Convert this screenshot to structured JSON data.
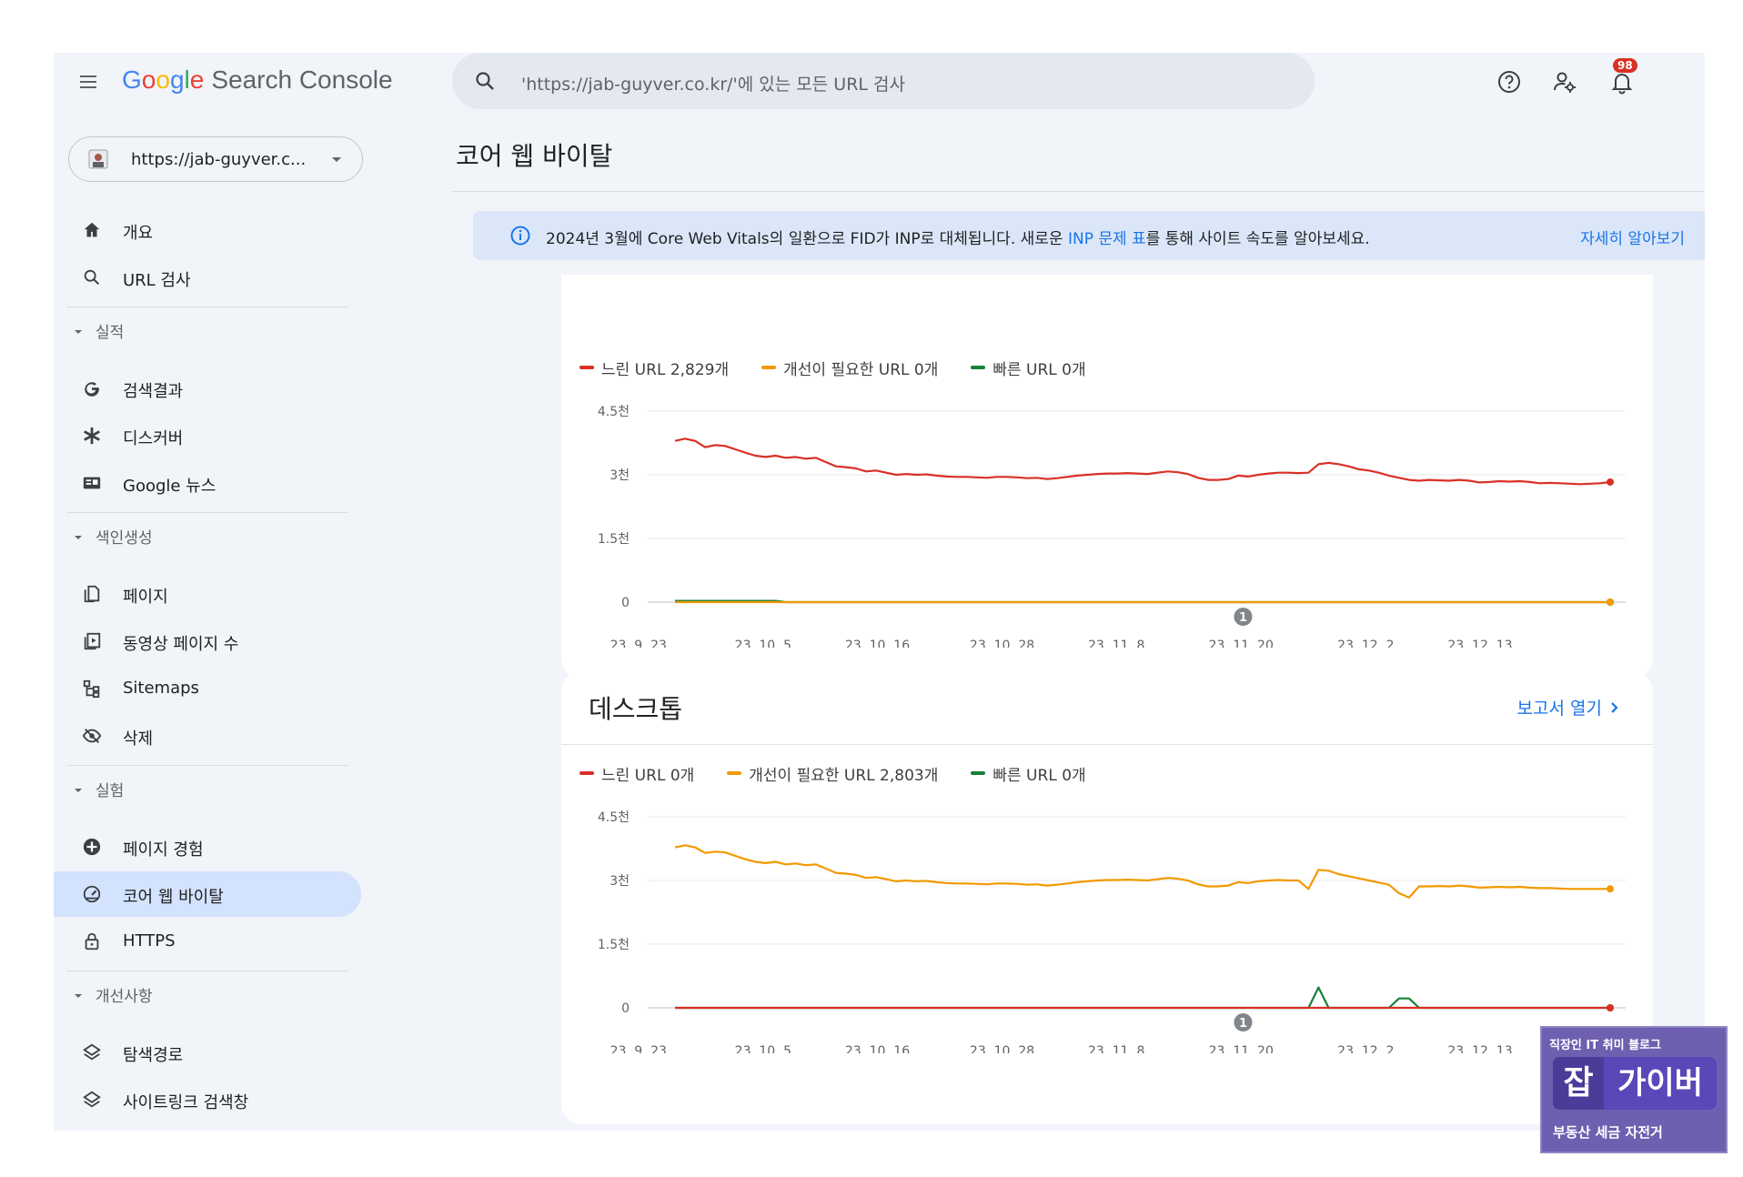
{
  "header": {
    "logo_google": [
      "G",
      "o",
      "o",
      "g",
      "l",
      "e"
    ],
    "product_name": "Search Console",
    "search_placeholder": "'https://jab-guyver.co.kr/'에 있는 모든 URL 검사",
    "notifications_count": "98",
    "icons": [
      "menu-icon",
      "search-icon",
      "help-icon",
      "manage-users-icon",
      "notifications-icon"
    ]
  },
  "sidebar": {
    "property": "https://jab-guyver.c...",
    "top_items": [
      {
        "label": "개요",
        "icon": "home-icon"
      },
      {
        "label": "URL 검사",
        "icon": "search-icon"
      }
    ],
    "sections": [
      {
        "title": "실적",
        "items": [
          {
            "label": "검색결과",
            "icon": "google-g-icon"
          },
          {
            "label": "디스커버",
            "icon": "asterisk-icon"
          },
          {
            "label": "Google 뉴스",
            "icon": "news-icon"
          }
        ]
      },
      {
        "title": "색인생성",
        "items": [
          {
            "label": "페이지",
            "icon": "pages-icon"
          },
          {
            "label": "동영상 페이지 수",
            "icon": "video-pages-icon"
          },
          {
            "label": "Sitemaps",
            "icon": "sitemap-icon"
          },
          {
            "label": "삭제",
            "icon": "removal-icon"
          }
        ]
      },
      {
        "title": "실험",
        "items": [
          {
            "label": "페이지 경험",
            "icon": "page-experience-icon"
          },
          {
            "label": "코어 웹 바이탈",
            "icon": "gauge-icon",
            "active": true
          },
          {
            "label": "HTTPS",
            "icon": "lock-icon"
          }
        ]
      },
      {
        "title": "개선사항",
        "items": [
          {
            "label": "탐색경로",
            "icon": "layers-icon"
          },
          {
            "label": "사이트링크 검색창",
            "icon": "layers-icon"
          }
        ]
      }
    ]
  },
  "main": {
    "page_title": "코어 웹 바이탈",
    "banner": {
      "text_before": "2024년 3월에 Core Web Vitals의 일환으로 FID가 INP로 대체됩니다. 새로운 ",
      "link_text": "INP 문제 표",
      "text_after": "를 통해 사이트 속도를 알아보세요.",
      "more_link": "자세히 알아보기"
    },
    "desktop_card": {
      "title": "데스크톱",
      "open_report": "보고서 열기"
    }
  },
  "colors": {
    "poor": "#d93025",
    "needs_improvement": "#f29900",
    "good": "#188038",
    "accent": "#1a73e8"
  },
  "chart_data": [
    {
      "type": "line",
      "name": "mobile",
      "legend": [
        "느린 URL 2,829개",
        "개선이 필요한 URL 0개",
        "빠른 URL 0개"
      ],
      "y_ticks": [
        "4.5천",
        "3천",
        "1.5천",
        "0"
      ],
      "ylim": [
        0,
        4500
      ],
      "x_ticks": [
        "23. 9. 23.",
        "23. 10. 5.",
        "23. 10. 16.",
        "23. 10. 28.",
        "23. 11. 8.",
        "23. 11. 20.",
        "23. 12. 2.",
        "23. 12. 13."
      ],
      "x_range": [
        "2023-09-23",
        "2023-12-22"
      ],
      "annotation": {
        "label": "1",
        "date": "2023-11-20"
      },
      "series": [
        {
          "name": "느린 URL",
          "color": "#d93025",
          "values": [
            3800,
            3850,
            3800,
            3650,
            3700,
            3680,
            3600,
            3520,
            3450,
            3420,
            3450,
            3400,
            3420,
            3380,
            3400,
            3300,
            3200,
            3180,
            3150,
            3080,
            3100,
            3050,
            3000,
            3020,
            3000,
            3010,
            2980,
            2960,
            2950,
            2950,
            2940,
            2930,
            2950,
            2950,
            2940,
            2920,
            2930,
            2900,
            2920,
            2950,
            2980,
            3000,
            3020,
            3030,
            3030,
            3040,
            3030,
            3020,
            3050,
            3080,
            3060,
            3020,
            2930,
            2880,
            2880,
            2900,
            2980,
            2960,
            3000,
            3030,
            3050,
            3050,
            3040,
            3050,
            3250,
            3280,
            3250,
            3200,
            3130,
            3100,
            3050,
            2980,
            2930,
            2880,
            2860,
            2880,
            2870,
            2860,
            2880,
            2860,
            2820,
            2830,
            2850,
            2840,
            2850,
            2830,
            2800,
            2810,
            2800,
            2790,
            2780,
            2790,
            2800,
            2829
          ]
        },
        {
          "name": "개선이 필요한 URL",
          "color": "#f29900",
          "values": [
            0,
            0,
            0,
            0,
            0,
            0,
            0,
            0,
            0,
            0,
            0,
            0,
            0,
            0,
            0,
            0,
            0,
            0,
            0,
            0,
            0,
            0,
            0,
            0,
            0,
            0,
            0,
            0,
            0,
            0,
            0,
            0,
            0,
            0,
            0,
            0,
            0,
            0,
            0,
            0,
            0,
            0,
            0,
            0,
            0,
            0,
            0,
            0,
            0,
            0,
            0,
            0,
            0,
            0,
            0,
            0,
            0,
            0,
            0,
            0,
            0,
            0,
            0,
            0,
            0,
            0,
            0,
            0,
            0,
            0,
            0,
            0,
            0,
            0,
            0,
            0,
            0,
            0,
            0,
            0,
            0,
            0,
            0,
            0,
            0,
            0,
            0,
            0,
            0,
            0,
            0,
            0,
            0,
            0
          ]
        },
        {
          "name": "빠른 URL",
          "color": "#188038",
          "values": [
            30,
            30,
            30,
            30,
            30,
            30,
            30,
            30,
            30,
            30,
            30,
            0,
            0,
            0,
            0,
            0,
            0,
            0,
            0,
            0,
            0,
            0,
            0,
            0,
            0,
            0,
            0,
            0,
            0,
            0,
            0,
            0,
            0,
            0,
            0,
            0,
            0,
            0,
            0,
            0,
            0,
            0,
            0,
            0,
            0,
            0,
            0,
            0,
            0,
            0,
            0,
            0,
            0,
            0,
            0,
            0,
            0,
            0,
            0,
            0,
            0,
            0,
            0,
            0,
            0,
            0,
            0,
            0,
            0,
            0,
            0,
            0,
            0,
            0,
            0,
            0,
            0,
            0,
            0,
            0,
            0,
            0,
            0,
            0,
            0,
            0,
            0,
            0,
            0,
            0,
            0,
            0,
            0,
            0
          ]
        }
      ]
    },
    {
      "type": "line",
      "name": "desktop",
      "title": "데스크톱",
      "legend": [
        "느린 URL 0개",
        "개선이 필요한 URL 2,803개",
        "빠른 URL 0개"
      ],
      "y_ticks": [
        "4.5천",
        "3천",
        "1.5천",
        "0"
      ],
      "ylim": [
        0,
        4500
      ],
      "x_ticks": [
        "23. 9. 23.",
        "23. 10. 5.",
        "23. 10. 16.",
        "23. 10. 28.",
        "23. 11. 8.",
        "23. 11. 20.",
        "23. 12. 2.",
        "23. 12. 13."
      ],
      "x_range": [
        "2023-09-23",
        "2023-12-22"
      ],
      "annotation": {
        "label": "1",
        "date": "2023-11-20"
      },
      "series": [
        {
          "name": "느린 URL",
          "color": "#d93025",
          "values": [
            0,
            0,
            0,
            0,
            0,
            0,
            0,
            0,
            0,
            0,
            0,
            0,
            0,
            0,
            0,
            0,
            0,
            0,
            0,
            0,
            0,
            0,
            0,
            0,
            0,
            0,
            0,
            0,
            0,
            0,
            0,
            0,
            0,
            0,
            0,
            0,
            0,
            0,
            0,
            0,
            0,
            0,
            0,
            0,
            0,
            0,
            0,
            0,
            0,
            0,
            0,
            0,
            0,
            0,
            0,
            0,
            0,
            0,
            0,
            0,
            0,
            0,
            0,
            0,
            0,
            0,
            0,
            0,
            0,
            0,
            0,
            0,
            0,
            0,
            0,
            0,
            0,
            0,
            0,
            0,
            0,
            0,
            0,
            0,
            0,
            0,
            0,
            0,
            0,
            0,
            0,
            0,
            0,
            0
          ]
        },
        {
          "name": "개선이 필요한 URL",
          "color": "#f29900",
          "values": [
            3780,
            3830,
            3780,
            3650,
            3680,
            3660,
            3580,
            3500,
            3440,
            3410,
            3440,
            3380,
            3400,
            3360,
            3380,
            3280,
            3180,
            3160,
            3130,
            3060,
            3080,
            3030,
            2980,
            3000,
            2980,
            2990,
            2960,
            2940,
            2930,
            2930,
            2920,
            2910,
            2930,
            2930,
            2920,
            2900,
            2910,
            2880,
            2900,
            2930,
            2960,
            2980,
            3000,
            3010,
            3010,
            3020,
            3010,
            3000,
            3030,
            3060,
            3040,
            3000,
            2910,
            2860,
            2860,
            2880,
            2960,
            2940,
            2980,
            3000,
            3010,
            3000,
            3000,
            2800,
            3250,
            3230,
            3150,
            3100,
            3050,
            3000,
            2950,
            2900,
            2700,
            2600,
            2860,
            2860,
            2870,
            2860,
            2880,
            2860,
            2830,
            2840,
            2850,
            2840,
            2850,
            2830,
            2820,
            2820,
            2810,
            2800,
            2800,
            2800,
            2800,
            2803
          ]
        },
        {
          "name": "빠른 URL",
          "color": "#188038",
          "values": [
            0,
            0,
            0,
            0,
            0,
            0,
            0,
            0,
            0,
            0,
            0,
            0,
            0,
            0,
            0,
            0,
            0,
            0,
            0,
            0,
            0,
            0,
            0,
            0,
            0,
            0,
            0,
            0,
            0,
            0,
            0,
            0,
            0,
            0,
            0,
            0,
            0,
            0,
            0,
            0,
            0,
            0,
            0,
            0,
            0,
            0,
            0,
            0,
            0,
            0,
            0,
            0,
            0,
            0,
            0,
            0,
            0,
            0,
            0,
            0,
            0,
            0,
            0,
            0,
            480,
            0,
            0,
            0,
            0,
            0,
            0,
            0,
            220,
            220,
            0,
            0,
            0,
            0,
            0,
            0,
            0,
            0,
            0,
            0,
            0,
            0,
            0,
            0,
            0,
            0,
            0,
            0,
            0,
            0
          ]
        }
      ]
    }
  ],
  "watermark": {
    "top": "직장인 IT 취미 블로그",
    "char": "잡",
    "name": "가이버",
    "bottom": "부동산 세금 자전거"
  }
}
